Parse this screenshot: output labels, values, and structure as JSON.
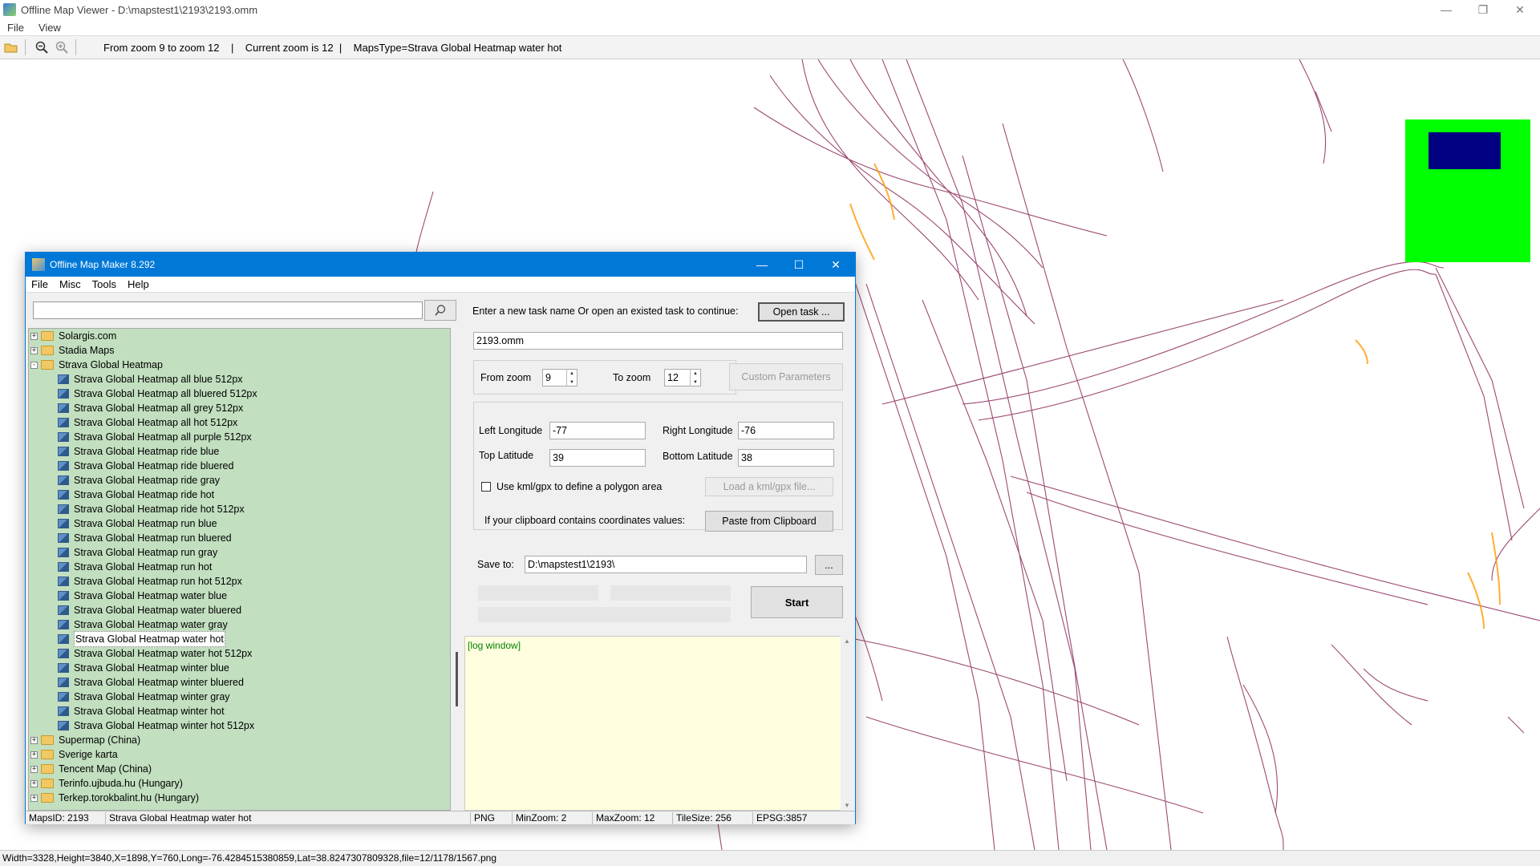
{
  "viewer": {
    "title": "Offline Map Viewer - D:\\mapstest1\\2193\\2193.omm",
    "menu": [
      "File",
      "View"
    ],
    "toolbar_info": "From zoom 9 to zoom 12    |    Current zoom is 12  |    MapsType=Strava Global Heatmap water hot",
    "status": "Width=3328,Height=3840,X=1898,Y=760,Long=-76.4284515380859,Lat=38.8247307809328,file=12/1178/1567.png",
    "window_controls": [
      "minimize-icon",
      "restore-icon",
      "close-icon"
    ]
  },
  "dialog": {
    "title": "Offline Map Maker 8.292",
    "menu": [
      "File",
      "Misc",
      "Tools",
      "Help"
    ],
    "search": {
      "value": "",
      "placeholder": ""
    },
    "tree": [
      {
        "label": "Solargis.com",
        "type": "folder",
        "expander": "+",
        "level": 0
      },
      {
        "label": "Stadia Maps",
        "type": "folder",
        "expander": "+",
        "level": 0
      },
      {
        "label": "Strava Global Heatmap",
        "type": "folder",
        "expander": "-",
        "level": 0
      },
      {
        "label": "Strava Global Heatmap all blue 512px",
        "type": "map",
        "level": 1
      },
      {
        "label": "Strava Global Heatmap all bluered 512px",
        "type": "map",
        "level": 1
      },
      {
        "label": "Strava Global Heatmap all grey 512px",
        "type": "map",
        "level": 1
      },
      {
        "label": "Strava Global Heatmap all hot 512px",
        "type": "map",
        "level": 1
      },
      {
        "label": "Strava Global Heatmap all purple 512px",
        "type": "map",
        "level": 1
      },
      {
        "label": "Strava Global Heatmap ride blue",
        "type": "map",
        "level": 1
      },
      {
        "label": "Strava Global Heatmap ride bluered",
        "type": "map",
        "level": 1
      },
      {
        "label": "Strava Global Heatmap ride gray",
        "type": "map",
        "level": 1
      },
      {
        "label": "Strava Global Heatmap ride hot",
        "type": "map",
        "level": 1
      },
      {
        "label": "Strava Global Heatmap ride hot 512px",
        "type": "map",
        "level": 1
      },
      {
        "label": "Strava Global Heatmap run blue",
        "type": "map",
        "level": 1
      },
      {
        "label": "Strava Global Heatmap run bluered",
        "type": "map",
        "level": 1
      },
      {
        "label": "Strava Global Heatmap run gray",
        "type": "map",
        "level": 1
      },
      {
        "label": "Strava Global Heatmap run hot",
        "type": "map",
        "level": 1
      },
      {
        "label": "Strava Global Heatmap run hot 512px",
        "type": "map",
        "level": 1
      },
      {
        "label": "Strava Global Heatmap water blue",
        "type": "map",
        "level": 1
      },
      {
        "label": "Strava Global Heatmap water bluered",
        "type": "map",
        "level": 1
      },
      {
        "label": "Strava Global Heatmap water gray",
        "type": "map",
        "level": 1
      },
      {
        "label": "Strava Global Heatmap water hot",
        "type": "map",
        "level": 1,
        "selected": true
      },
      {
        "label": "Strava Global Heatmap water hot 512px",
        "type": "map",
        "level": 1
      },
      {
        "label": "Strava Global Heatmap winter blue",
        "type": "map",
        "level": 1
      },
      {
        "label": "Strava Global Heatmap winter bluered",
        "type": "map",
        "level": 1
      },
      {
        "label": "Strava Global Heatmap winter gray",
        "type": "map",
        "level": 1
      },
      {
        "label": "Strava Global Heatmap winter hot",
        "type": "map",
        "level": 1
      },
      {
        "label": "Strava Global Heatmap winter hot 512px",
        "type": "map",
        "level": 1
      },
      {
        "label": "Supermap (China)",
        "type": "folder",
        "expander": "+",
        "level": 0
      },
      {
        "label": "Sverige karta",
        "type": "folder",
        "expander": "+",
        "level": 0
      },
      {
        "label": "Tencent Map (China)",
        "type": "folder",
        "expander": "+",
        "level": 0
      },
      {
        "label": "Terinfo.ujbuda.hu (Hungary)",
        "type": "folder",
        "expander": "+",
        "level": 0
      },
      {
        "label": "Terkep.torokbalint.hu (Hungary)",
        "type": "folder",
        "expander": "+",
        "level": 0
      }
    ],
    "task": {
      "prompt": "Enter a new task name Or open an existed task to continue:",
      "open_task_label": "Open task ...",
      "task_name": "2193.omm"
    },
    "zoom": {
      "from_label": "From zoom",
      "from_value": "9",
      "to_label": "To zoom",
      "to_value": "12",
      "custom_params_label": "Custom Parameters"
    },
    "coords": {
      "left_lon_label": "Left Longitude",
      "left_lon": "-77",
      "right_lon_label": "Right Longitude",
      "right_lon": "-76",
      "top_lat_label": "Top Latitude",
      "top_lat": "39",
      "bottom_lat_label": "Bottom Latitude",
      "bottom_lat": "38",
      "kml_checkbox_label": "Use kml/gpx to define a polygon area",
      "kml_checked": false,
      "load_kml_label": "Load a kml/gpx file...",
      "clipboard_prompt": "If your clipboard contains coordinates values:",
      "paste_label": "Paste from Clipboard"
    },
    "save": {
      "label": "Save to:",
      "path": "D:\\mapstest1\\2193\\",
      "browse_label": "..."
    },
    "start_label": "Start",
    "log_text": "[log window]",
    "status": {
      "maps_id": "MapsID: 2193",
      "map_name": "Strava Global Heatmap water hot",
      "format": "PNG",
      "min_zoom": "MinZoom: 2",
      "max_zoom": "MaxZoom: 12",
      "tile_size": "TileSize: 256",
      "epsg": "EPSG:3857"
    }
  },
  "colors": {
    "accent": "#0078d7",
    "tree_bg": "#c2dfc0",
    "log_bg": "#ffffe0",
    "heatmap_line": "#8b2a5a",
    "heatmap_hot": "#ff9a00",
    "minimap_bg": "#00ff00",
    "minimap_view": "#000080"
  }
}
